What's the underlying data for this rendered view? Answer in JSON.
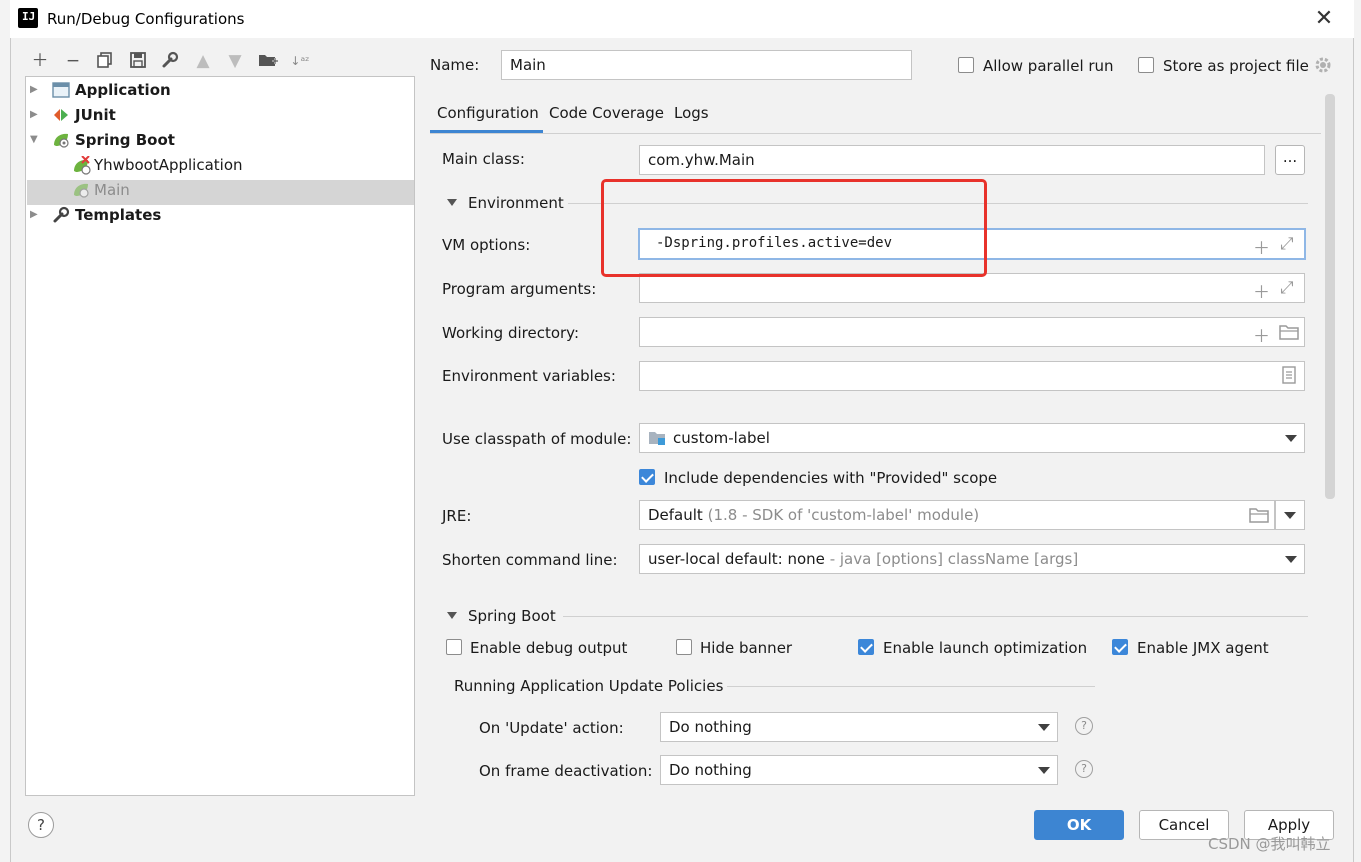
{
  "window": {
    "title": "Run/Debug Configurations",
    "app_icon_letters": "IJ"
  },
  "tree": {
    "items": [
      {
        "label": "Application",
        "bold": true
      },
      {
        "label": "JUnit",
        "bold": true
      },
      {
        "label": "Spring Boot",
        "bold": true
      },
      {
        "label": "YhwbootApplication",
        "bold": false
      },
      {
        "label": "Main",
        "bold": false,
        "selected": true
      },
      {
        "label": "Templates",
        "bold": true
      }
    ]
  },
  "header": {
    "name_label": "Name:",
    "name_value": "Main",
    "allow_parallel_label": "Allow parallel run",
    "store_project_label": "Store as project file"
  },
  "tabs": [
    {
      "label": "Configuration",
      "active": true
    },
    {
      "label": "Code Coverage",
      "active": false
    },
    {
      "label": "Logs",
      "active": false
    }
  ],
  "form": {
    "main_class_label": "Main class:",
    "main_class_value": "com.yhw.Main",
    "browse_label": "...",
    "environment_label": "Environment",
    "vm_options_label": "VM options:",
    "vm_options_value": "-Dspring.profiles.active=dev",
    "program_args_label": "Program arguments:",
    "program_args_value": "",
    "working_dir_label": "Working directory:",
    "working_dir_value": "",
    "env_vars_label": "Environment variables:",
    "env_vars_value": "",
    "classpath_label": "Use classpath of module:",
    "classpath_value": "custom-label",
    "include_deps_label": "Include dependencies with \"Provided\" scope",
    "jre_label": "JRE:",
    "jre_value": "Default",
    "jre_hint": "(1.8 - SDK of 'custom-label' module)",
    "shorten_label": "Shorten command line:",
    "shorten_value": "user-local default: none",
    "shorten_hint": "- java [options] className [args]"
  },
  "spring_boot": {
    "section_label": "Spring Boot",
    "enable_debug_label": "Enable debug output",
    "hide_banner_label": "Hide banner",
    "launch_opt_label": "Enable launch optimization",
    "jmx_label": "Enable JMX agent",
    "policies_label": "Running Application Update Policies",
    "update_action_label": "On 'Update' action:",
    "update_action_value": "Do nothing",
    "frame_deact_label": "On frame deactivation:",
    "frame_deact_value": "Do nothing",
    "help_glyph": "?"
  },
  "footer": {
    "help_glyph": "?",
    "ok_label": "OK",
    "cancel_label": "Cancel",
    "apply_label": "Apply"
  },
  "watermark": "CSDN @我叫韩立",
  "colors": {
    "accent": "#3d85d2",
    "highlight_box": "#e8322b",
    "selection": "#d5d5d5"
  }
}
